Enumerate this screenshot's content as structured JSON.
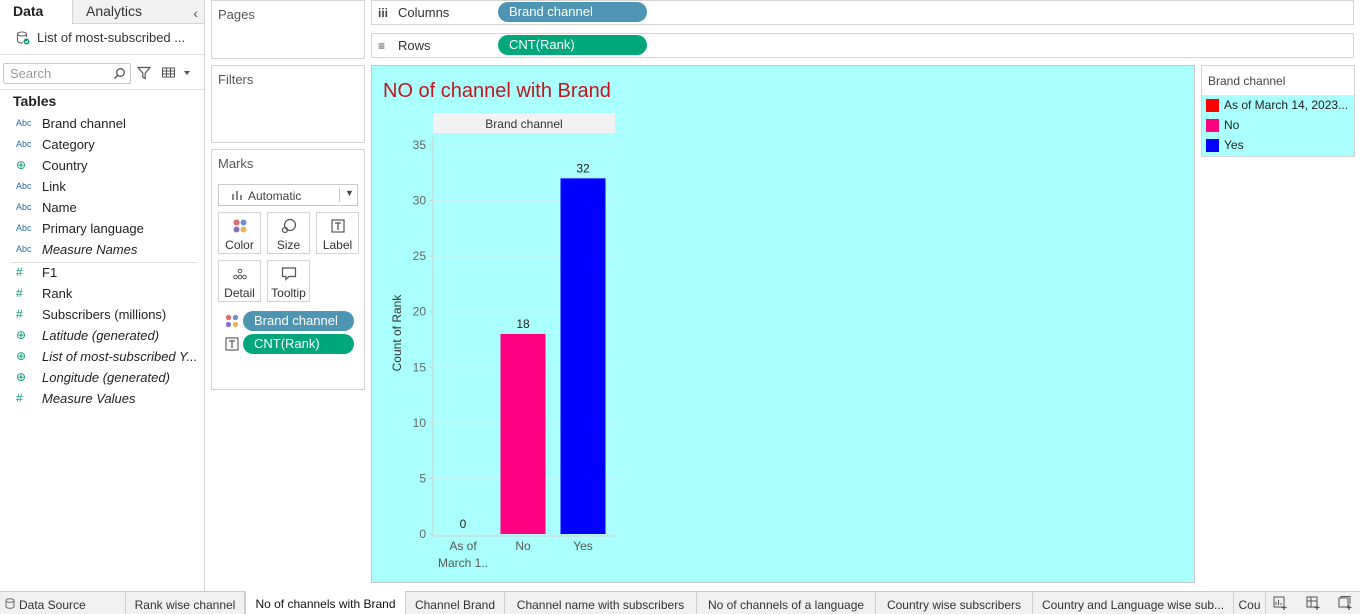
{
  "data_pane": {
    "tab_data": "Data",
    "tab_analytics": "Analytics",
    "datasource": "List of most-subscribed ...",
    "search_placeholder": "Search",
    "tables_heading": "Tables",
    "fields": [
      {
        "type": "Abc",
        "label": "Brand channel",
        "italic": false
      },
      {
        "type": "Abc",
        "label": "Category",
        "italic": false
      },
      {
        "type": "geo",
        "label": "Country",
        "italic": false
      },
      {
        "type": "Abc",
        "label": "Link",
        "italic": false
      },
      {
        "type": "Abc",
        "label": "Name",
        "italic": false
      },
      {
        "type": "Abc",
        "label": "Primary language",
        "italic": false
      },
      {
        "type": "Abc",
        "label": "Measure Names",
        "italic": true
      },
      {
        "type": "#",
        "label": "F1",
        "italic": false
      },
      {
        "type": "#",
        "label": "Rank",
        "italic": false
      },
      {
        "type": "#",
        "label": "Subscribers (millions)",
        "italic": false
      },
      {
        "type": "geo",
        "label": "Latitude (generated)",
        "italic": true
      },
      {
        "type": "geo",
        "label": "List of most-subscribed Y...",
        "italic": true
      },
      {
        "type": "geo",
        "label": "Longitude (generated)",
        "italic": true
      },
      {
        "type": "#",
        "label": "Measure Values",
        "italic": true
      }
    ]
  },
  "cards": {
    "pages": "Pages",
    "filters": "Filters",
    "marks": "Marks",
    "marks_type": "Automatic",
    "mark_buttons": [
      "Color",
      "Size",
      "Label",
      "Detail",
      "Tooltip"
    ],
    "mark_pills": [
      "Brand channel",
      "CNT(Rank)"
    ]
  },
  "shelves": {
    "columns_label": "Columns",
    "columns_pill": "Brand channel",
    "rows_label": "Rows",
    "rows_pill": "CNT(Rank)"
  },
  "legend": {
    "title": "Brand channel",
    "items": [
      {
        "label": "As of March 14, 2023...",
        "color": "#ff0000"
      },
      {
        "label": "No",
        "color": "#ff0080"
      },
      {
        "label": "Yes",
        "color": "#0000ff"
      }
    ]
  },
  "chart_data": {
    "type": "bar",
    "title": "NO of channel with Brand",
    "header": "Brand channel",
    "xlabel": "",
    "ylabel": "Count of Rank",
    "categories": [
      "As of March 1..",
      "No",
      "Yes"
    ],
    "category_lines": [
      [
        "As of",
        "March 1.."
      ],
      [
        "No"
      ],
      [
        "Yes"
      ]
    ],
    "values": [
      0,
      18,
      32
    ],
    "colors": [
      "#ff0000",
      "#ff0080",
      "#0000ff"
    ],
    "ylim": [
      0,
      35
    ],
    "yticks": [
      0,
      5,
      10,
      15,
      20,
      25,
      30,
      35
    ],
    "background": "#aaffff",
    "title_color": "#c0161c"
  },
  "sheet_tabs": {
    "data_source": "Data Source",
    "tabs": [
      "Rank wise channel",
      "No of channels with Brand",
      "Channel Brand",
      "Channel name with subscribers",
      "No of channels of a language",
      "Country wise subscribers",
      "Country and Language wise sub...",
      "Cou"
    ],
    "active_index": 1
  }
}
